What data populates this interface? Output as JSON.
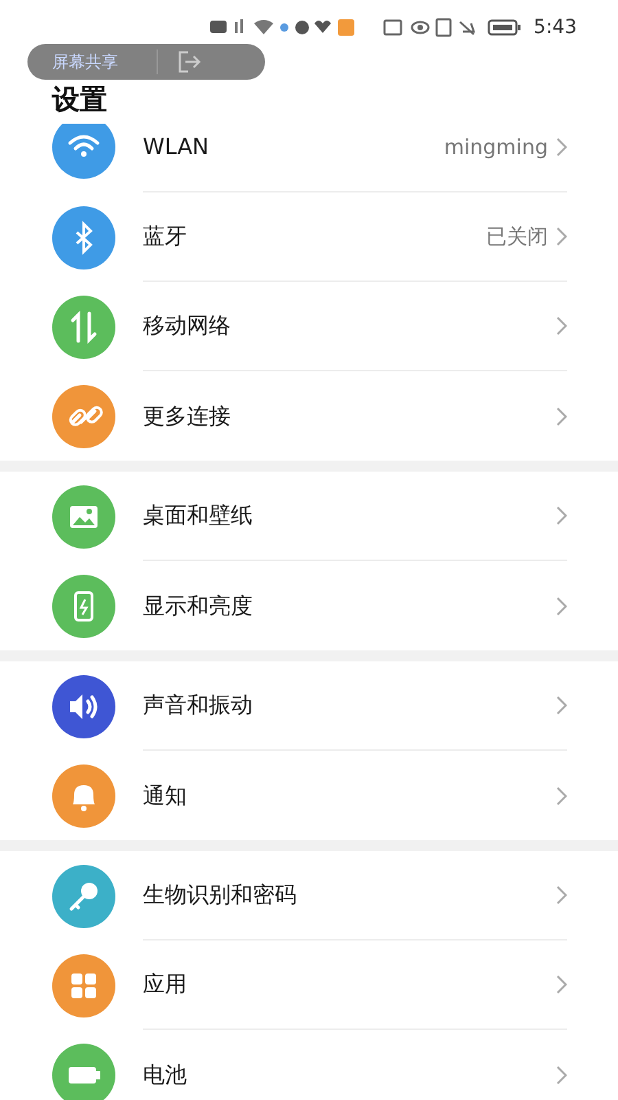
{
  "status_bar": {
    "time": "5:43"
  },
  "screen_share_pill": {
    "label": "屏幕共享"
  },
  "title": "设置",
  "groups": [
    {
      "items": [
        {
          "label": "WLAN",
          "value": "mingming",
          "color": "#3f9be6"
        },
        {
          "label": "蓝牙",
          "value": "已关闭",
          "color": "#3f9be6"
        },
        {
          "label": "移动网络",
          "color": "#5cbd5c"
        },
        {
          "label": "更多连接",
          "color": "#f0953a"
        }
      ]
    },
    {
      "items": [
        {
          "label": "桌面和壁纸",
          "color": "#5cbd5c"
        },
        {
          "label": "显示和亮度",
          "color": "#5cbd5c"
        }
      ]
    },
    {
      "items": [
        {
          "label": "声音和振动",
          "color": "#3f56d4"
        },
        {
          "label": "通知",
          "color": "#f0953a"
        }
      ]
    },
    {
      "items": [
        {
          "label": "生物识别和密码",
          "color": "#3cb0c8"
        },
        {
          "label": "应用",
          "color": "#f0953a"
        },
        {
          "label": "电池",
          "color": "#5cbd5c"
        }
      ]
    }
  ]
}
